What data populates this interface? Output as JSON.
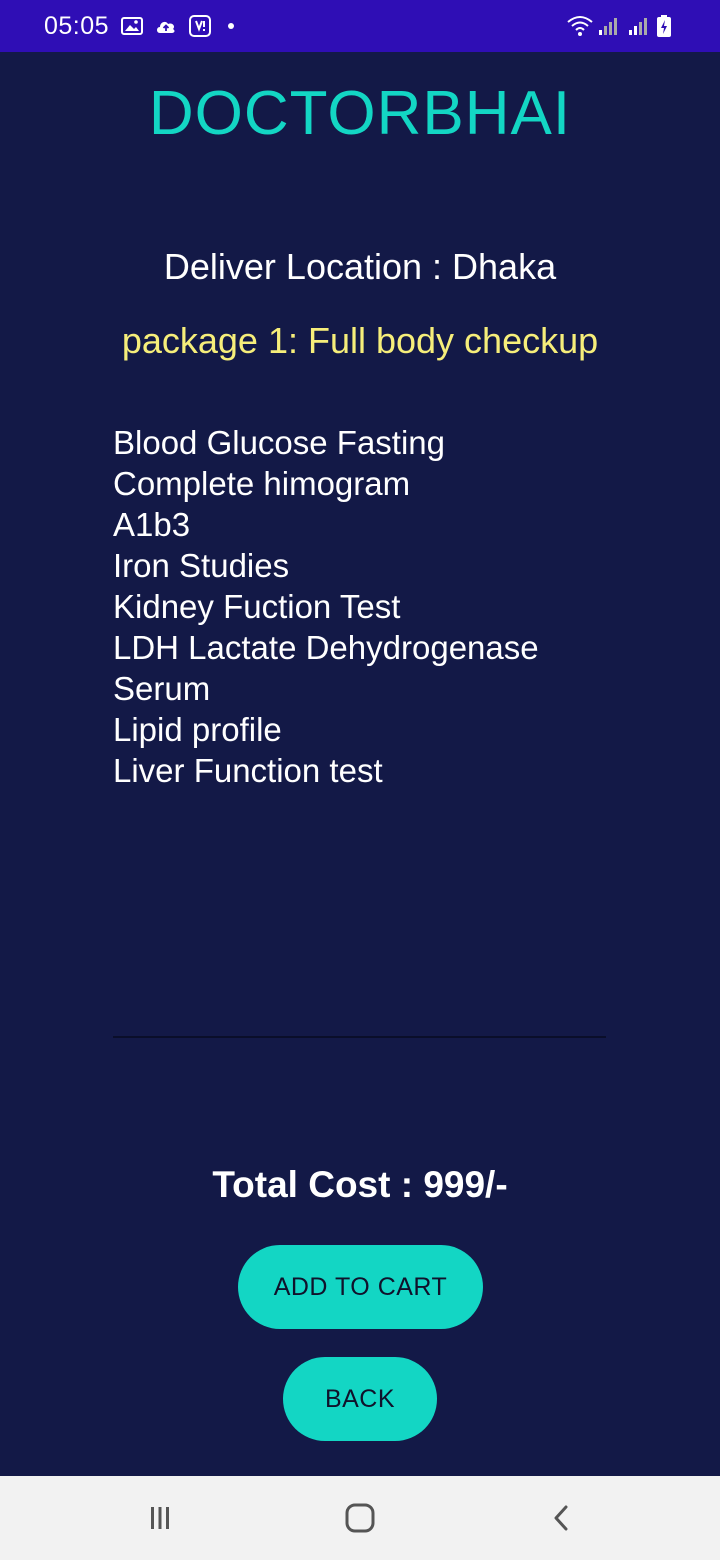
{
  "status_bar": {
    "time": "05:05",
    "left_icons": [
      "image-icon",
      "cloud-upload-icon",
      "app-notification-icon",
      "dot-icon"
    ],
    "right_icons": [
      "wifi-icon",
      "signal-icon",
      "signal-icon",
      "battery-charging-icon"
    ]
  },
  "app": {
    "title": "DOCTORBHAI",
    "location": "Deliver Location : Dhaka",
    "package": "package 1: Full body checkup",
    "tests": [
      "Blood Glucose Fasting",
      "Complete himogram",
      "A1b3",
      "Iron Studies",
      "Kidney Fuction Test",
      "LDH Lactate Dehydrogenase",
      "Serum",
      "Lipid profile",
      "Liver Function test"
    ],
    "total": "Total Cost : 999/-",
    "add_to_cart_label": "ADD TO CART",
    "back_label": "BACK"
  },
  "nav_bar": {
    "icons": [
      "recent-apps-icon",
      "home-icon",
      "back-icon"
    ]
  },
  "colors": {
    "background": "#131947",
    "status_bar": "#2f0eb5",
    "accent": "#13d6c4",
    "package_text": "#f6ee7a"
  }
}
